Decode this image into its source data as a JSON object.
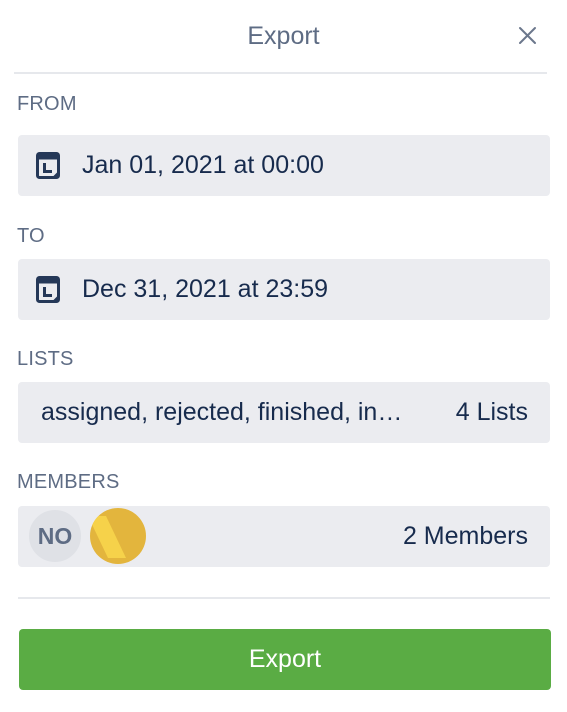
{
  "dialog": {
    "title": "Export"
  },
  "from": {
    "label": "FROM",
    "value": "Jan 01, 2021 at 00:00"
  },
  "to": {
    "label": "TO",
    "value": "Dec 31, 2021 at 23:59"
  },
  "lists": {
    "label": "LISTS",
    "value": "assigned, rejected, finished, in…",
    "count": "4 Lists"
  },
  "members": {
    "label": "MEMBERS",
    "avatars": [
      {
        "initials": "NO",
        "color": "#dfe1e6"
      },
      {
        "initials": "",
        "color": "#e3b53d"
      }
    ],
    "count": "2 Members"
  },
  "actions": {
    "export_label": "Export"
  },
  "colors": {
    "primary": "#5aac44",
    "field_bg": "#ebecf0",
    "label_text": "#5e6c84",
    "value_text": "#172b4d"
  },
  "icons": {
    "close": "close-icon",
    "calendar": "calendar-icon"
  }
}
